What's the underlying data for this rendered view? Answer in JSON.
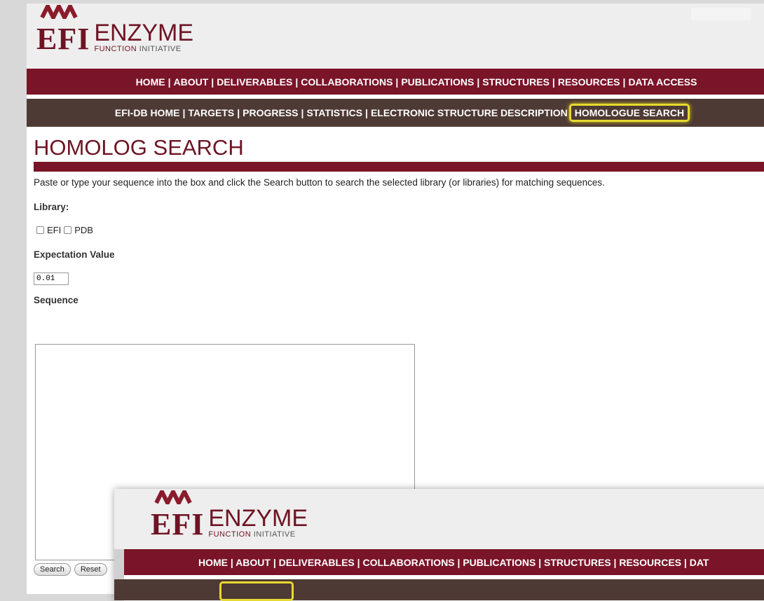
{
  "logo": {
    "efi": "EFI",
    "enzyme": "ENZYME",
    "function": "FUNCTION",
    "initiative": "INITIATIVE"
  },
  "nav_main": [
    "HOME",
    "ABOUT",
    "DELIVERABLES",
    "COLLABORATIONS",
    "PUBLICATIONS",
    "STRUCTURES",
    "RESOURCES",
    "DATA ACCESS"
  ],
  "nav_sub": [
    "EFI-DB HOME",
    "TARGETS",
    "PROGRESS",
    "STATISTICS",
    "ELECTRONIC STRUCTURE DESCRIPTION"
  ],
  "nav_sub_active": "HOMOLOGUE SEARCH",
  "page": {
    "title": "HOMOLOG SEARCH",
    "intro": "Paste or type your sequence into the box and click the Search button to search the selected library (or libraries) for matching sequences.",
    "library_label": "Library:",
    "lib_efi": "EFI",
    "lib_pdb": "PDB",
    "ev_label": "Expectation Value",
    "ev_value": "0.01",
    "seq_label": "Sequence",
    "search_btn": "Search",
    "reset_btn": "Reset"
  },
  "overlay": {
    "nav_main_text": "HOME | ABOUT | DELIVERABLES | COLLABORATIONS | PUBLICATIONS | STRUCTURES | RESOURCES | DAT"
  },
  "colors": {
    "maroon": "#7a1428",
    "brown": "#4e3a34",
    "highlight": "#e6d930"
  }
}
